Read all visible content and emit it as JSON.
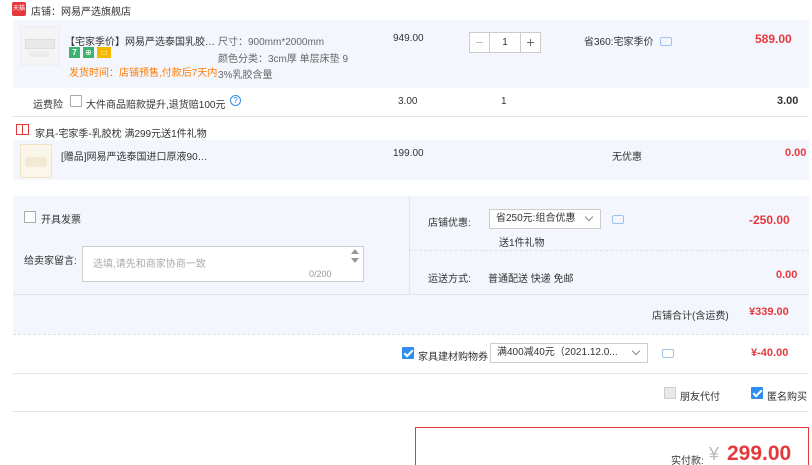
{
  "shop": {
    "icon_label": "天猫",
    "name": "店铺：网易严选旗舰店"
  },
  "item1": {
    "title": "【宅家季价】网易严选泰国乳胶…",
    "badges": [
      "7",
      "⊕",
      "▭"
    ],
    "ship_note": "发货时间：店铺预售,付款后7天内",
    "spec_size": "尺寸：900mm*2000mm",
    "spec_color": "颜色分类：3cm厚 单层床垫 9",
    "spec_color2": "3%乳胶含量",
    "price": "949.00",
    "quantity": "1",
    "saving": "省360:宅家季价",
    "total": "589.00"
  },
  "insurance": {
    "label": "运费险",
    "desc": "大件商品赔款提升,退货赔100元",
    "price": "3.00",
    "quantity": "1",
    "total": "3.00"
  },
  "gift": {
    "header": "家具-宅家季-乳胶枕   满299元送1件礼物",
    "title": "[赠品]网易严选泰国进口原液90…",
    "price": "199.00",
    "discount": "无优惠",
    "total": "0.00"
  },
  "options": {
    "invoice_label": "开具发票",
    "message_label": "给卖家留言:",
    "message_placeholder": "选填,请先和商家协商一致",
    "message_count": "0/200",
    "shop_discount_label": "店铺优惠:",
    "shop_discount_value": "省250元:组合优惠",
    "shop_discount_note": "送1件礼物",
    "shop_discount_amount": "-250.00",
    "shipping_label": "运送方式:",
    "shipping_value": "普通配送 快递 免邮",
    "shipping_amount": "0.00",
    "subtotal_label": "店铺合计(含运费)",
    "subtotal_value": "¥339.00"
  },
  "coupon": {
    "label": "家具建材购物券",
    "value": "满400减40元（2021.12.0...",
    "amount": "¥-40.00"
  },
  "checkout": {
    "friend_pay": "朋友代付",
    "anonymous": "匿名购买",
    "pay_label": "实付款:",
    "currency": "¥",
    "pay_amount": "299.00"
  },
  "colors": {
    "accent_red": "#e4393c",
    "accent_blue": "#2f8cf0",
    "band_bg": "#f3f7fd"
  }
}
